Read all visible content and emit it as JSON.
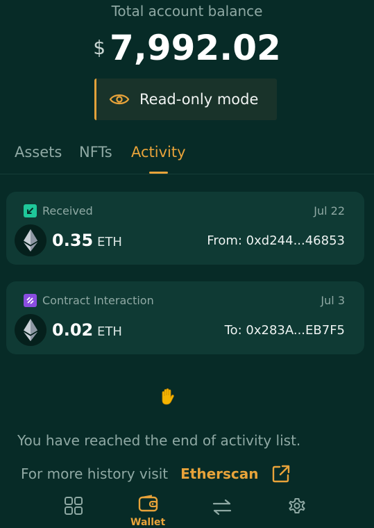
{
  "balance": {
    "label": "Total account balance",
    "currency": "$",
    "amount": "7,992.02"
  },
  "mode_banner": {
    "label": "Read-only mode",
    "icon": "eye-icon"
  },
  "tabs": [
    {
      "label": "Assets",
      "active": false
    },
    {
      "label": "NFTs",
      "active": false
    },
    {
      "label": "Activity",
      "active": true
    }
  ],
  "activity": [
    {
      "type": "Received",
      "type_icon": "arrow-down-left-icon",
      "date": "Jul 22",
      "amount": "0.35",
      "unit": "ETH",
      "counterparty": "From: 0xd244...46853"
    },
    {
      "type": "Contract Interaction",
      "type_icon": "contract-icon",
      "date": "Jul 3",
      "amount": "0.02",
      "unit": "ETH",
      "counterparty": "To: 0x283A...EB7F5"
    }
  ],
  "end_message": "You have reached the end of activity list.",
  "history": {
    "text": "For more history visit",
    "link": "Etherscan"
  },
  "bottom_nav": {
    "active_label": "Wallet",
    "items": [
      "apps-icon",
      "wallet-icon",
      "swap-icon",
      "settings-icon"
    ]
  },
  "colors": {
    "background": "#072b27",
    "card": "#0f3a34",
    "accent": "#e8a33a",
    "received_icon": "#1fc79a",
    "contract_icon": "#8a4de0"
  }
}
